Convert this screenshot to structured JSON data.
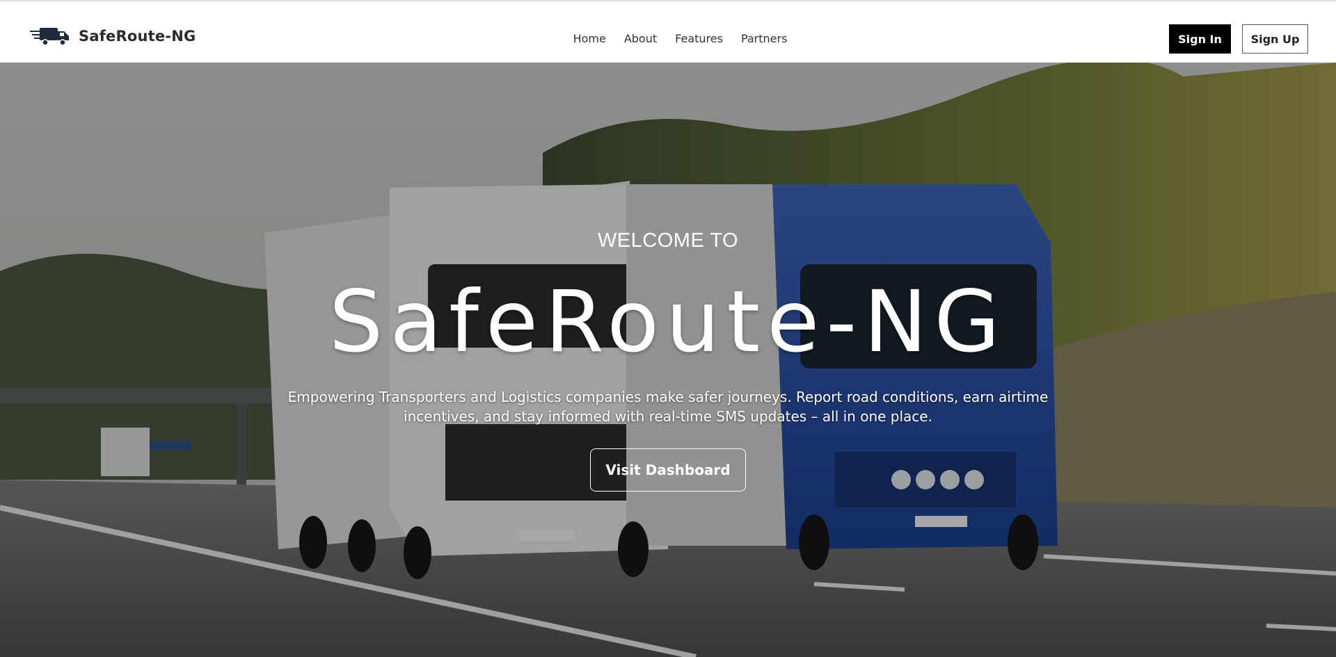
{
  "brand": {
    "name": "SafeRoute-NG",
    "icon": "delivery-truck-icon"
  },
  "nav": {
    "items": [
      {
        "label": "Home"
      },
      {
        "label": "About"
      },
      {
        "label": "Features"
      },
      {
        "label": "Partners"
      }
    ]
  },
  "auth": {
    "signin_label": "Sign In",
    "signup_label": "Sign Up"
  },
  "hero": {
    "eyebrow": "WELCOME TO",
    "title": "SafeRoute-NG",
    "description": "Empowering Transporters and Logistics companies make safer journeys. Report road conditions, earn airtime incentives, and stay informed with real-time SMS updates – all in one place.",
    "cta_label": "Visit Dashboard",
    "background": "highway-trucks-photo"
  },
  "colors": {
    "brand_dark": "#2b2b2b",
    "signin_bg": "#000000",
    "hero_overlay": "rgba(0,0,0,0.30)"
  }
}
